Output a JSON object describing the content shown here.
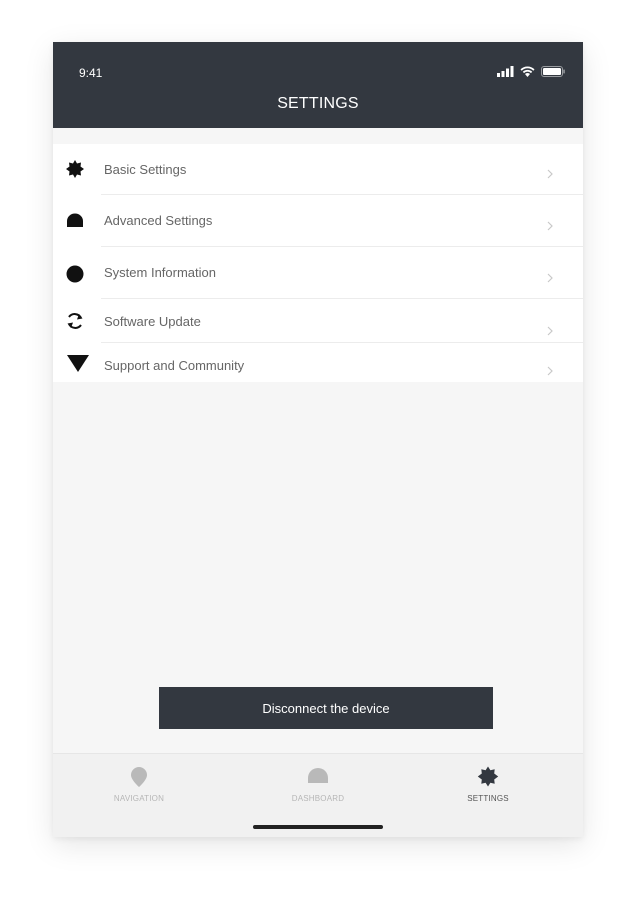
{
  "status_bar": {
    "time": "9:41"
  },
  "header": {
    "title": "SETTINGS"
  },
  "settings": {
    "items": [
      {
        "label": "Basic Settings",
        "icon": "gear-icon"
      },
      {
        "label": "Advanced Settings",
        "icon": "advanced-settings-icon"
      },
      {
        "label": "System Information",
        "icon": "info-icon"
      },
      {
        "label": "Software Update",
        "icon": "refresh-icon"
      },
      {
        "label": "Support and Community",
        "icon": "support-icon"
      }
    ]
  },
  "actions": {
    "disconnect_label": "Disconnect the device"
  },
  "bottom_nav": {
    "items": [
      {
        "label": "NAVIGATION",
        "icon": "location-pin-icon",
        "active": false
      },
      {
        "label": "DASHBOARD",
        "icon": "dashboard-icon",
        "active": false
      },
      {
        "label": "SETTINGS",
        "icon": "gear-icon",
        "active": true
      }
    ]
  },
  "colors": {
    "header_bg": "#333840",
    "button_bg": "#333840",
    "screen_bg": "#f6f6f6",
    "list_bg": "#ffffff",
    "nav_inactive": "#b6b6b6",
    "nav_active": "#333840"
  }
}
